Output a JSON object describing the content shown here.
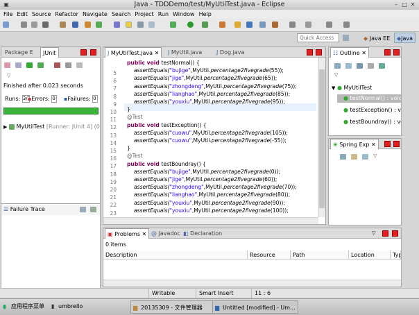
{
  "window": {
    "title": "Java - TDDDemo/test/MyUtilTest.java - Eclipse"
  },
  "menu": [
    "File",
    "Edit",
    "Source",
    "Refactor",
    "Navigate",
    "Search",
    "Project",
    "Run",
    "Window",
    "Help"
  ],
  "toolbar": {
    "quick_access_placeholder": "Quick Access",
    "perspectives": [
      "Java EE",
      "Java"
    ]
  },
  "left_panel": {
    "tabs": [
      "Package E",
      "JUnit"
    ],
    "status": "Finished after 0.023 seconds",
    "runs_label": "Runs:",
    "runs_value": "3/3",
    "errors_label": "Errors:",
    "errors_value": "0",
    "failures_label": "Failures:",
    "failures_value": "0",
    "tree_item_name": "MyUtilTest",
    "tree_item_runner": "[Runner: JUnit 4] (0",
    "failure_trace_label": "Failure Trace"
  },
  "editor": {
    "tabs": [
      "MyUtilTest.java",
      "MyUtil.java",
      "Dog.java"
    ],
    "lines": [
      {
        "n": "5",
        "parts": [
          [
            "kw",
            "public void "
          ],
          [
            "",
            "testNormal() {"
          ]
        ]
      },
      {
        "n": "6",
        "parts": [
          [
            "it",
            "assertEquals("
          ],
          [
            "str",
            "\"bujige\""
          ],
          [
            "",
            ",MyUtil."
          ],
          [
            "it",
            "percentage2fivegrade"
          ],
          [
            "",
            "(55));"
          ]
        ]
      },
      {
        "n": "7",
        "parts": [
          [
            "it",
            "assertEquals("
          ],
          [
            "str",
            "\"jige\""
          ],
          [
            "",
            ",MyUtil."
          ],
          [
            "it",
            "percentage2fivegrade"
          ],
          [
            "",
            "(65));"
          ]
        ]
      },
      {
        "n": "8",
        "parts": [
          [
            "it",
            "assertEquals("
          ],
          [
            "str",
            "\"zhongdeng\""
          ],
          [
            "",
            ",MyUtil."
          ],
          [
            "it",
            "percentage2fivegrade"
          ],
          [
            "",
            "(75));"
          ]
        ]
      },
      {
        "n": "9",
        "parts": [
          [
            "it",
            "assertEquals("
          ],
          [
            "str",
            "\"lianghao\""
          ],
          [
            "",
            ",MyUtil."
          ],
          [
            "it",
            "percentage2fivegrade"
          ],
          [
            "",
            "(85));"
          ]
        ]
      },
      {
        "n": "10",
        "parts": [
          [
            "it",
            "assertEquals("
          ],
          [
            "str",
            "\"youxiu\""
          ],
          [
            "",
            ",MyUtil."
          ],
          [
            "it",
            "percentage2fivegrade"
          ],
          [
            "",
            "(95));"
          ]
        ]
      },
      {
        "n": "11",
        "parts": [
          [
            "",
            "}"
          ]
        ]
      },
      {
        "n": "12",
        "parts": [
          [
            "ann",
            "@Test"
          ]
        ]
      },
      {
        "n": "13",
        "parts": [
          [
            "kw",
            "public void "
          ],
          [
            "",
            "testException() {"
          ]
        ]
      },
      {
        "n": "14",
        "parts": [
          [
            "it",
            "assertEquals("
          ],
          [
            "str",
            "\"cuowu\""
          ],
          [
            "",
            ",MyUtil."
          ],
          [
            "it",
            "percentage2fivegrade"
          ],
          [
            "",
            "(105));"
          ]
        ]
      },
      {
        "n": "15",
        "parts": [
          [
            "it",
            "assertEquals("
          ],
          [
            "str",
            "\"cuowu\""
          ],
          [
            "",
            ",MyUtil."
          ],
          [
            "it",
            "percentage2fivegrade"
          ],
          [
            "",
            "(-55));"
          ]
        ]
      },
      {
        "n": "16",
        "parts": [
          [
            "",
            "}"
          ]
        ]
      },
      {
        "n": "17",
        "parts": [
          [
            "ann",
            "@Test"
          ]
        ]
      },
      {
        "n": "18",
        "parts": [
          [
            "kw",
            "public void "
          ],
          [
            "",
            "testBoundray() {"
          ]
        ]
      },
      {
        "n": "19",
        "parts": [
          [
            "it",
            "assertEquals("
          ],
          [
            "str",
            "\"bujige\""
          ],
          [
            "",
            ",MyUtil."
          ],
          [
            "it",
            "percentage2fivegrade"
          ],
          [
            "",
            "(0));"
          ]
        ]
      },
      {
        "n": "20",
        "parts": [
          [
            "it",
            "assertEquals("
          ],
          [
            "str",
            "\"jige\""
          ],
          [
            "",
            ",MyUtil."
          ],
          [
            "it",
            "percentage2fivegrade"
          ],
          [
            "",
            "(60));"
          ]
        ]
      },
      {
        "n": "21",
        "parts": [
          [
            "it",
            "assertEquals("
          ],
          [
            "str",
            "\"zhongdeng\""
          ],
          [
            "",
            ",MyUtil."
          ],
          [
            "it",
            "percentage2fivegrade"
          ],
          [
            "",
            "(70));"
          ]
        ]
      },
      {
        "n": "22",
        "parts": [
          [
            "it",
            "assertEquals("
          ],
          [
            "str",
            "\"lianghao\""
          ],
          [
            "",
            ",MyUtil."
          ],
          [
            "it",
            "percentage2fivegrade"
          ],
          [
            "",
            "(80));"
          ]
        ]
      },
      {
        "n": "23",
        "parts": [
          [
            "it",
            "assertEquals("
          ],
          [
            "str",
            "\"youxiu\""
          ],
          [
            "",
            ",MyUtil."
          ],
          [
            "it",
            "percentage2fivegrade"
          ],
          [
            "",
            "(90));"
          ]
        ]
      },
      {
        "n": "24",
        "parts": [
          [
            "it",
            "assertEquals("
          ],
          [
            "str",
            "\"youxiu\""
          ],
          [
            "",
            ",MyUtil."
          ],
          [
            "it",
            "percentage2fivegrade"
          ],
          [
            "",
            "(100));"
          ]
        ]
      }
    ]
  },
  "outline": {
    "tab": "Outline",
    "class_name": "MyUtilTest",
    "methods": [
      "testNormal() : void",
      "testException() : vo",
      "testBoundray() : voi"
    ]
  },
  "spring": {
    "tab": "Spring Exp"
  },
  "problems": {
    "tabs": [
      "Problems",
      "Javadoc",
      "Declaration"
    ],
    "count": "0 items",
    "columns": [
      "Description",
      "Resource",
      "Path",
      "Location",
      "Typ"
    ]
  },
  "status_bar": {
    "mode": "Writable",
    "insert": "Smart Insert",
    "position": "11 : 6"
  },
  "taskbar": {
    "start": "应用程序菜单",
    "items": [
      "umbrello",
      "20135309 - 文件管理器",
      "Untitled [modified] - Um..."
    ]
  },
  "colors": {
    "junit_bar": "#3cb43c",
    "keyword": "#7f0055",
    "string": "#2a00ff",
    "close_button": "#e02020"
  }
}
